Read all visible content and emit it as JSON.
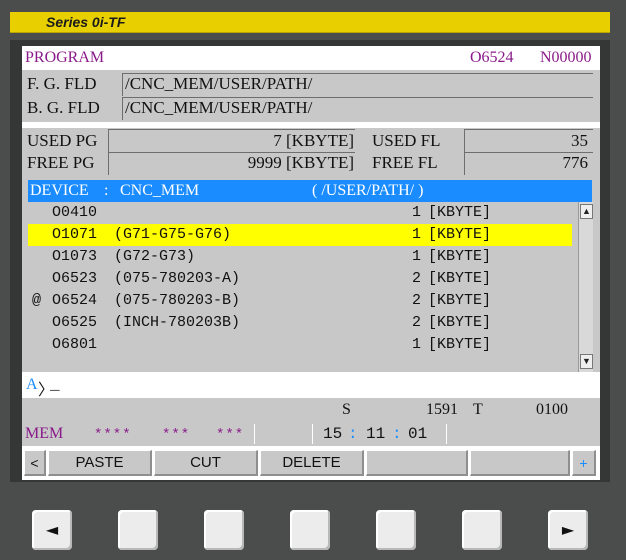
{
  "series_title": "Series 0i-TF",
  "header": {
    "title": "PROGRAM",
    "program_no": "O6524",
    "sequence_no": "N00000"
  },
  "folders": [
    {
      "label": "F. G. FLD",
      "path": "/CNC_MEM/USER/PATH/"
    },
    {
      "label": "B. G. FLD",
      "path": "/CNC_MEM/USER/PATH/"
    }
  ],
  "memory": {
    "used_pg_label": "USED PG",
    "used_pg_value": "7 [KBYTE]",
    "free_pg_label": "FREE PG",
    "free_pg_value": "9999 [KBYTE]",
    "used_fl_label": "USED FL",
    "used_fl_value": "35",
    "free_fl_label": "FREE FL",
    "free_fl_value": "776"
  },
  "device": {
    "label": "DEVICE",
    "colon": ":",
    "name": "CNC_MEM",
    "path": "( /USER/PATH/ )"
  },
  "programs": [
    {
      "marker": "",
      "number": "O0410",
      "comment": "",
      "size": "1",
      "unit": "[KBYTE]",
      "selected": false
    },
    {
      "marker": "",
      "number": "O1071",
      "comment": "(G71-G75-G76)",
      "size": "1",
      "unit": "[KBYTE]",
      "selected": true
    },
    {
      "marker": "",
      "number": "O1073",
      "comment": "(G72-G73)",
      "size": "1",
      "unit": "[KBYTE]",
      "selected": false
    },
    {
      "marker": "",
      "number": "O6523",
      "comment": "(075-780203-A)",
      "size": "2",
      "unit": "[KBYTE]",
      "selected": false
    },
    {
      "marker": "@",
      "number": "O6524",
      "comment": "(075-780203-B)",
      "size": "2",
      "unit": "[KBYTE]",
      "selected": false
    },
    {
      "marker": "",
      "number": "O6525",
      "comment": "(INCH-780203B)",
      "size": "2",
      "unit": "[KBYTE]",
      "selected": false
    },
    {
      "marker": "",
      "number": "O6801",
      "comment": "",
      "size": "1",
      "unit": "[KBYTE]",
      "selected": false
    }
  ],
  "input": {
    "prompt": "A",
    "chevron": "〉",
    "cursor": "_"
  },
  "status": {
    "s_label": "S",
    "s_value": "1591",
    "t_label": "T",
    "t_value": "0100",
    "mode": "MEM",
    "field1": "****",
    "field2": "***",
    "field3": "***",
    "clock_h": "15",
    "clock_m": "11",
    "clock_s": "01",
    "clock_sep": ":"
  },
  "softkeys": {
    "left": "<",
    "k1": "PASTE",
    "k2": "CUT",
    "k3": "DELETE",
    "k4": "",
    "k5": "",
    "right": "+"
  },
  "hardkeys": {
    "left_glyph": "◄",
    "right_glyph": "►"
  },
  "colors": {
    "selection": "#ffff00",
    "device_bar": "#1a8cff",
    "mode_text": "#8a1a8a",
    "series_bar": "#e8d000"
  },
  "icons": [
    "scroll-up-arrow-icon",
    "scroll-down-arrow-icon",
    "left-triangle-icon",
    "right-triangle-icon"
  ]
}
